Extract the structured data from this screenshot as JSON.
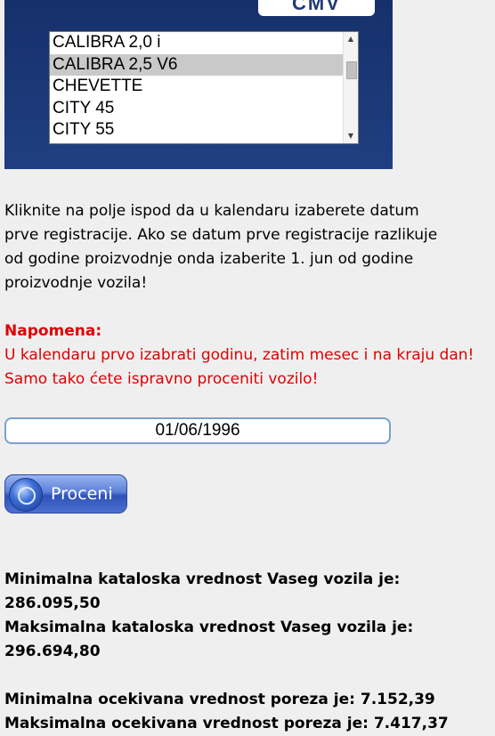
{
  "brand": {
    "logo_text": "CMV"
  },
  "models": {
    "items": [
      "CALIBRA 2,0 i",
      "CALIBRA 2,5 V6",
      "CHEVETTE",
      "CITY 45",
      "CITY 55"
    ],
    "selected": "CALIBRA 2,5 V6"
  },
  "instructions": {
    "line1": "Kliknite na polje ispod da u kalendaru izaberete datum",
    "line2": "prve registracije. Ako se datum prve registracije razlikuje",
    "line3": "od godine proizvodnje onda izaberite 1. jun od godine",
    "line4": "proizvodnje vozila!"
  },
  "note": {
    "title": "Napomena:",
    "line1": "U kalendaru prvo izabrati godinu, zatim mesec i na kraju dan!",
    "line2": "Samo tako ćete ispravno proceniti vozilo!",
    "color": "#e00000"
  },
  "date_field": {
    "value": "01/06/1996"
  },
  "estimate_button": {
    "label": "Proceni"
  },
  "results": {
    "min_catalog": "Minimalna kataloska vrednost Vaseg vozila je: 286.095,50",
    "max_catalog": "Maksimalna kataloska vrednost Vaseg vozila je: 296.694,80",
    "min_tax": "Minimalna ocekivana vrednost poreza je: 7.152,39",
    "max_tax": "Maksimalna ocekivana vrednost poreza je: 7.417,37"
  }
}
